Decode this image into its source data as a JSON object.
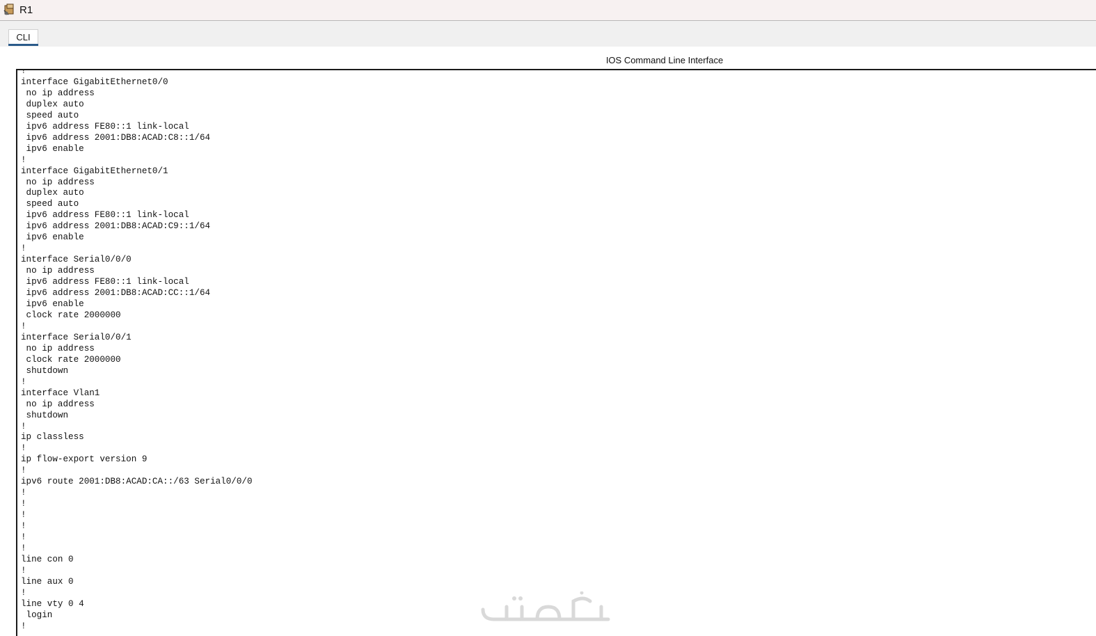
{
  "window": {
    "title": "R1",
    "icon": "router-icon"
  },
  "tabs": [
    {
      "label": "CLI",
      "active": true
    }
  ],
  "cli": {
    "heading": "IOS Command Line Interface",
    "lines": [
      "!",
      "interface GigabitEthernet0/0",
      " no ip address",
      " duplex auto",
      " speed auto",
      " ipv6 address FE80::1 link-local",
      " ipv6 address 2001:DB8:ACAD:C8::1/64",
      " ipv6 enable",
      "!",
      "interface GigabitEthernet0/1",
      " no ip address",
      " duplex auto",
      " speed auto",
      " ipv6 address FE80::1 link-local",
      " ipv6 address 2001:DB8:ACAD:C9::1/64",
      " ipv6 enable",
      "!",
      "interface Serial0/0/0",
      " no ip address",
      " ipv6 address FE80::1 link-local",
      " ipv6 address 2001:DB8:ACAD:CC::1/64",
      " ipv6 enable",
      " clock rate 2000000",
      "!",
      "interface Serial0/0/1",
      " no ip address",
      " clock rate 2000000",
      " shutdown",
      "!",
      "interface Vlan1",
      " no ip address",
      " shutdown",
      "!",
      "ip classless",
      "!",
      "ip flow-export version 9",
      "!",
      "ipv6 route 2001:DB8:ACAD:CA::/63 Serial0/0/0",
      "!",
      "!",
      "!",
      "!",
      "!",
      "!",
      "line con 0",
      "!",
      "line aux 0",
      "!",
      "line vty 0 4",
      " login",
      "!"
    ]
  },
  "colors": {
    "tab_accent": "#2b5b8a",
    "terminal_border": "#1a1a1a"
  }
}
